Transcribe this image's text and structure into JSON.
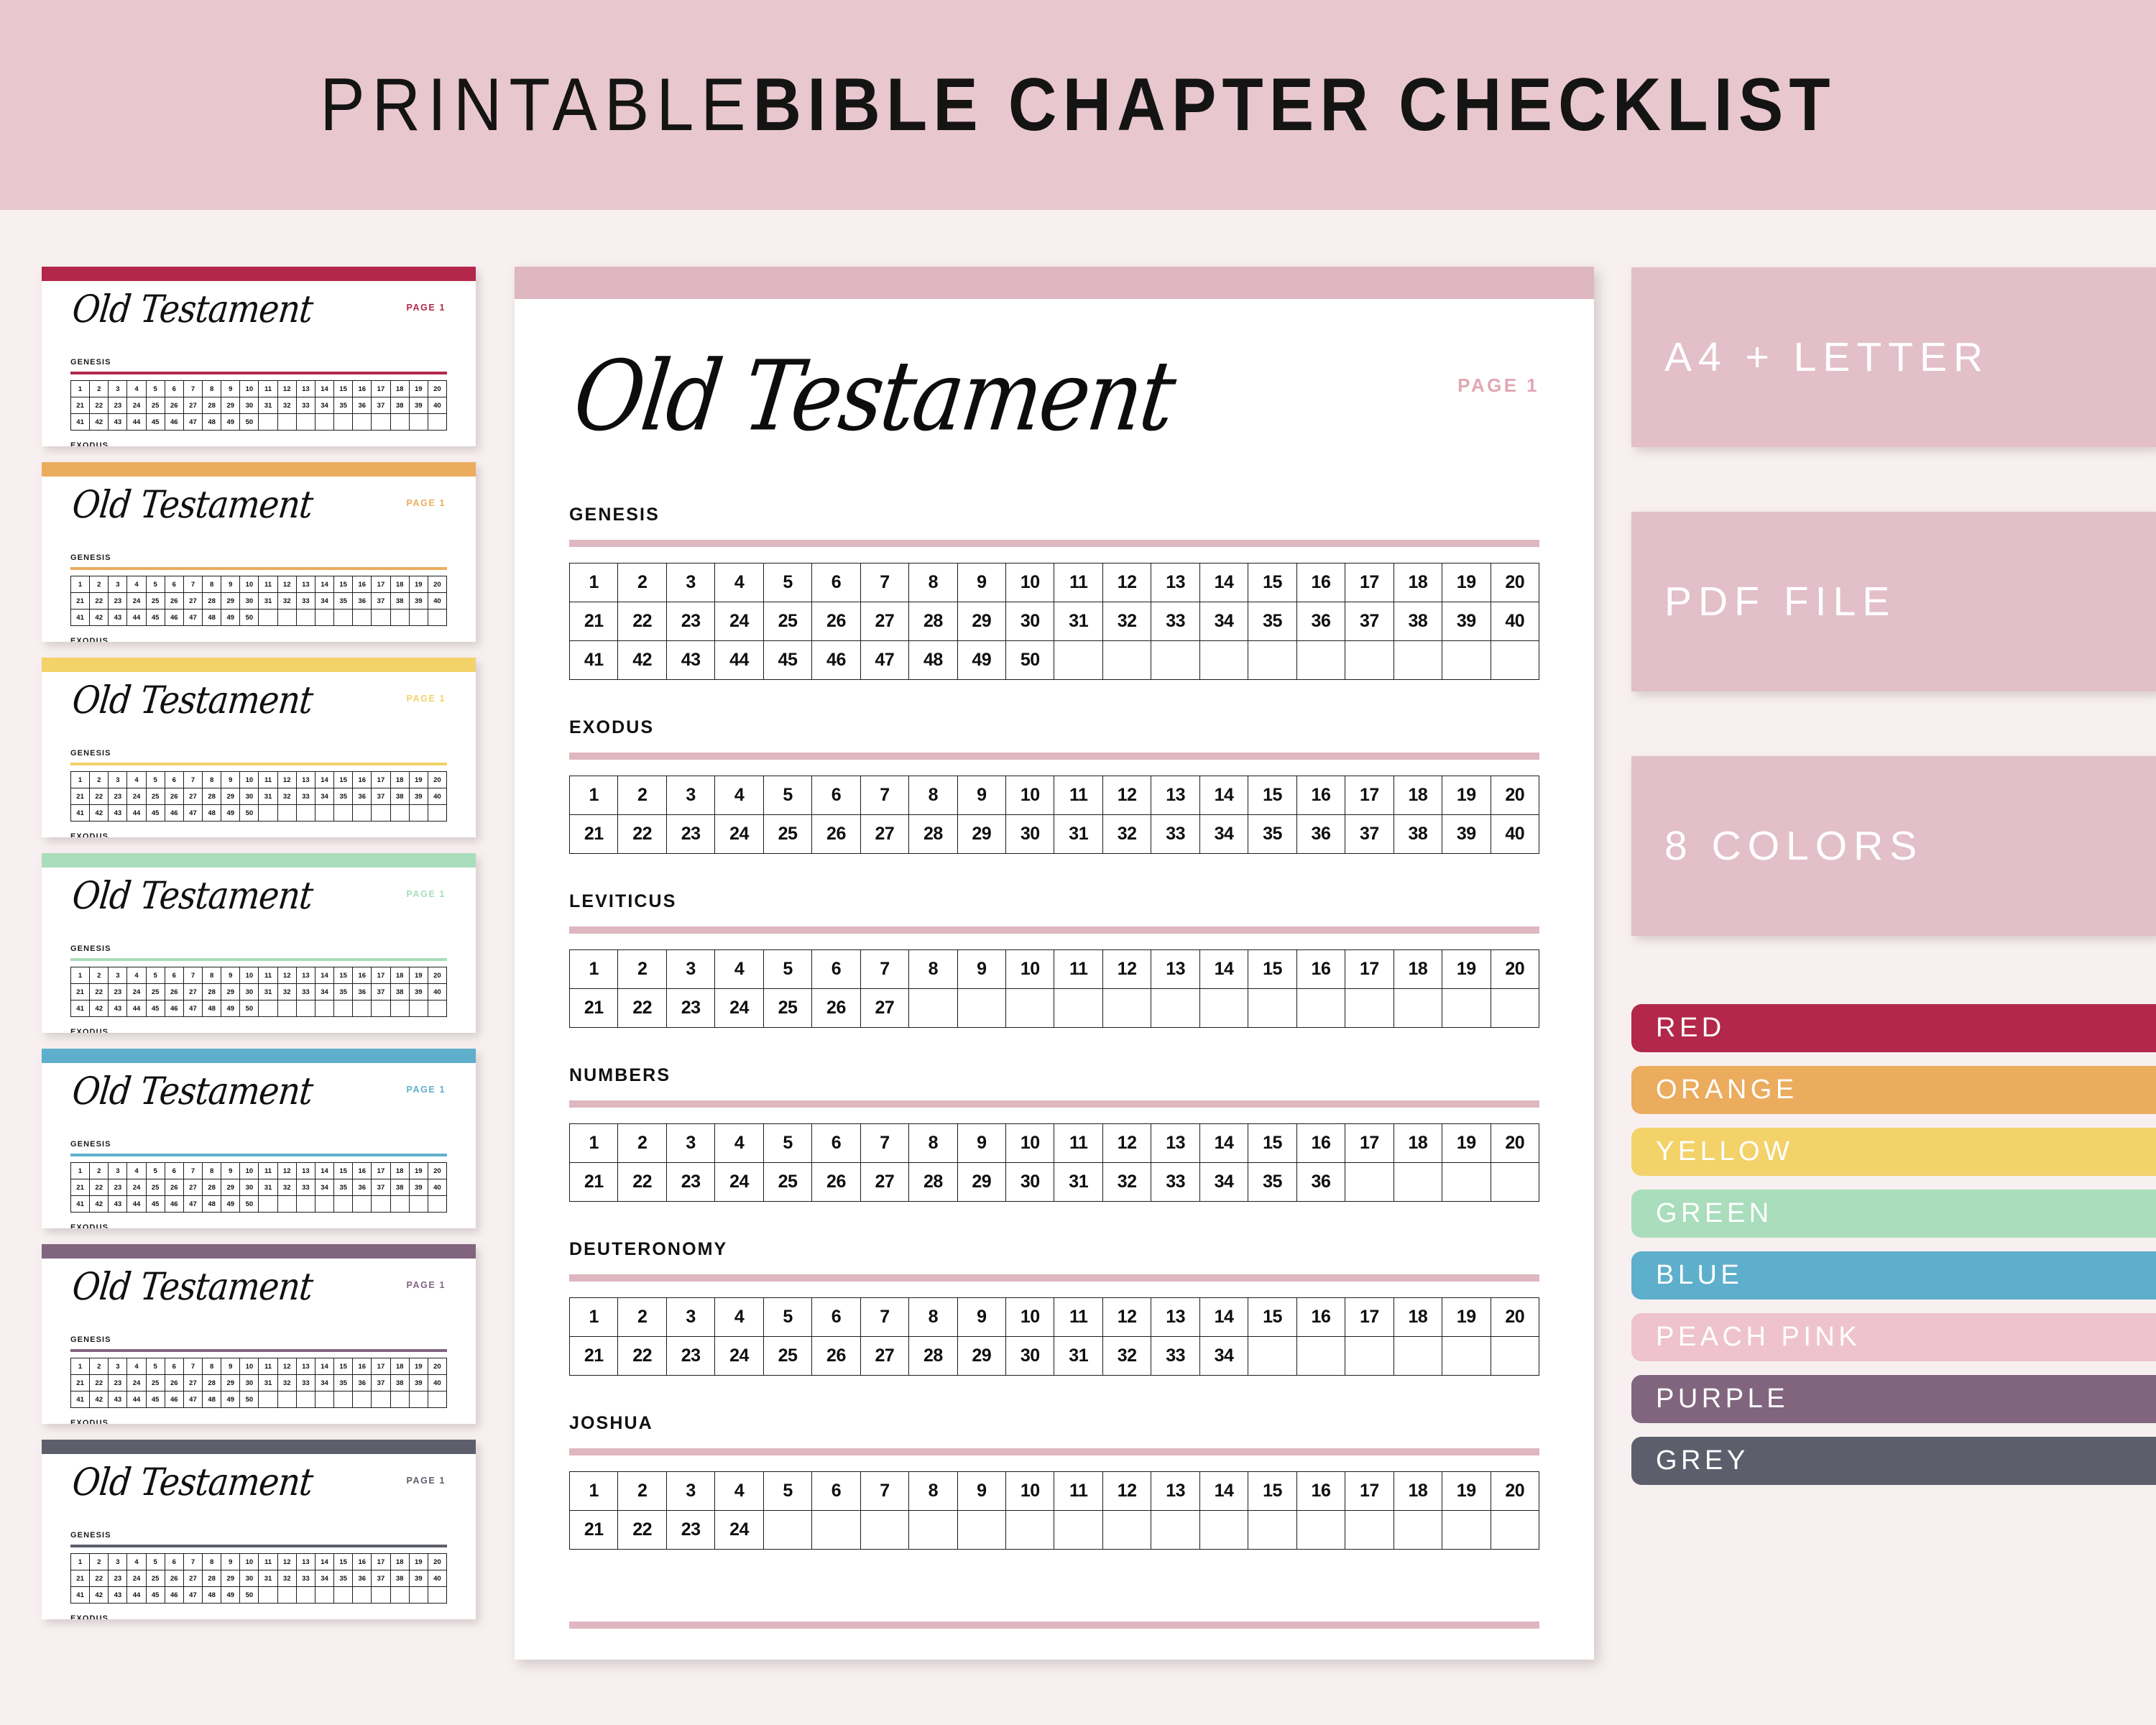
{
  "header": {
    "title_light": "PRINTABLE",
    "title_bold": "BIBLE CHAPTER CHECKLIST",
    "bg_color": "#E9C7CE"
  },
  "page_background": "#F8F0F0",
  "main_page": {
    "top_bar_color": "#DEB7C0",
    "accent_color": "#DEB7C0",
    "title": "Old Testament",
    "page_label": "PAGE 1",
    "page_label_color": "#E2A7B5",
    "books": [
      {
        "name": "GENESIS",
        "chapters": 50,
        "columns": 20,
        "rows": 3
      },
      {
        "name": "EXODUS",
        "chapters": 40,
        "columns": 20,
        "rows": 2
      },
      {
        "name": "LEVITICUS",
        "chapters": 27,
        "columns": 20,
        "rows": 2
      },
      {
        "name": "NUMBERS",
        "chapters": 36,
        "columns": 20,
        "rows": 2
      },
      {
        "name": "DEUTERONOMY",
        "chapters": 34,
        "columns": 20,
        "rows": 2
      },
      {
        "name": "JOSHUA",
        "chapters": 24,
        "columns": 20,
        "rows": 2
      }
    ]
  },
  "thumbnails": {
    "title": "Old Testament",
    "page_label": "PAGE 1",
    "book_1": "GENESIS",
    "book_2": "EXODUS",
    "grid_columns": 20,
    "grid_rows": 3,
    "grid_filled": 50,
    "cards": [
      {
        "color_name": "RED",
        "color": "#B3284A"
      },
      {
        "color_name": "ORANGE",
        "color": "#EBAC5E"
      },
      {
        "color_name": "YELLOW",
        "color": "#F3D269"
      },
      {
        "color_name": "GREEN",
        "color": "#A9DDBB"
      },
      {
        "color_name": "BLUE",
        "color": "#5EAFCC"
      },
      {
        "color_name": "PURPLE",
        "color": "#81657F"
      },
      {
        "color_name": "GREY",
        "color": "#5C5F6B"
      }
    ]
  },
  "right_rail": {
    "features": [
      {
        "label": "A4 + LETTER"
      },
      {
        "label": "PDF FILE"
      },
      {
        "label": "8 COLORS"
      }
    ],
    "feature_bg": "#E2BFC9",
    "colors": [
      {
        "label": "RED",
        "hex": "#B3284A"
      },
      {
        "label": "ORANGE",
        "hex": "#EBAC5E"
      },
      {
        "label": "YELLOW",
        "hex": "#F3D269"
      },
      {
        "label": "GREEN",
        "hex": "#A9DDBB"
      },
      {
        "label": "BLUE",
        "hex": "#5EAFCC"
      },
      {
        "label": "PEACH PINK",
        "hex": "#EEC3CE"
      },
      {
        "label": "PURPLE",
        "hex": "#81657F"
      },
      {
        "label": "GREY",
        "hex": "#5C5F6B"
      }
    ]
  }
}
